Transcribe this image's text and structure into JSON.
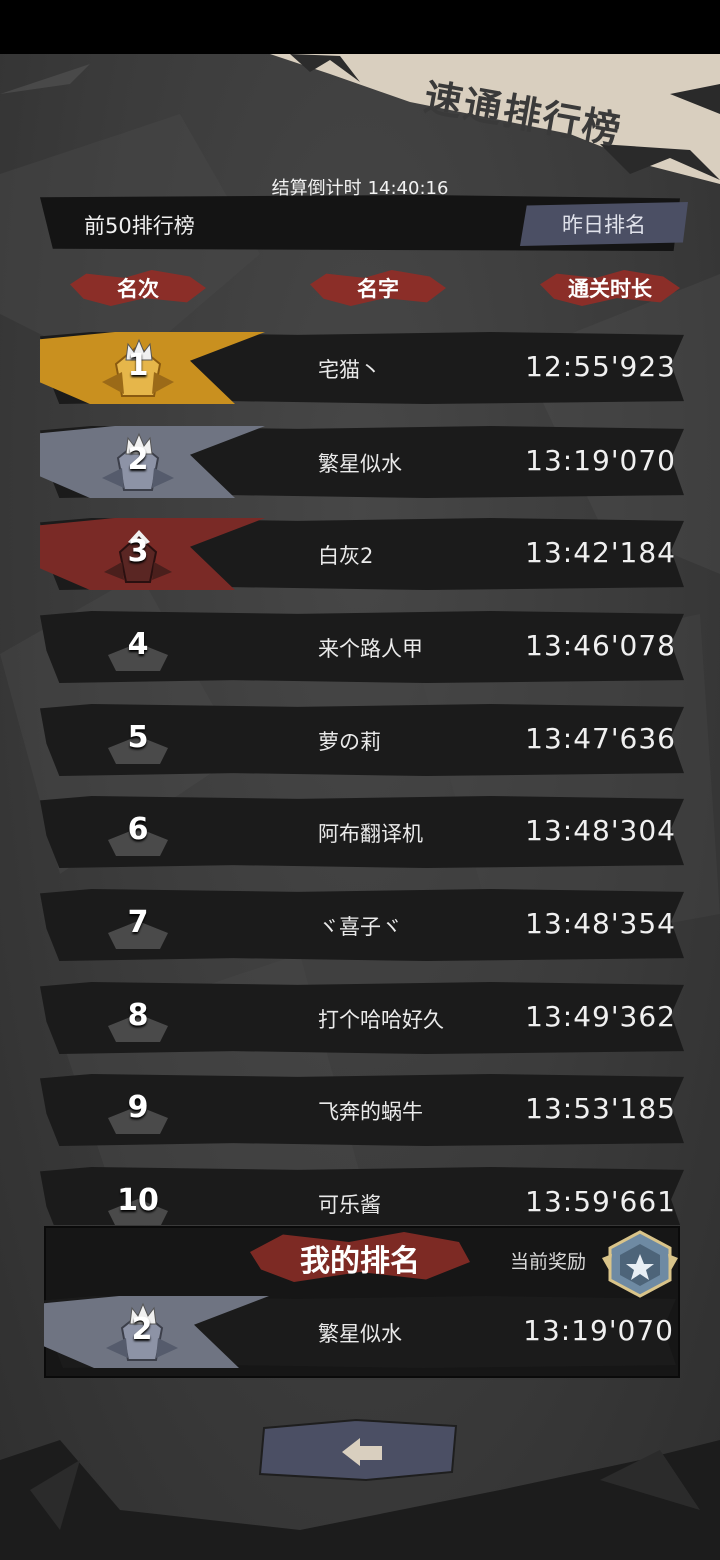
{
  "header": {
    "title": "速通排行榜",
    "countdown_label": "结算倒计时",
    "countdown_value": "14:40:16",
    "top_label": "前50排行榜",
    "yesterday_button": "昨日排名"
  },
  "columns": {
    "rank": "名次",
    "name": "名字",
    "time": "通关时长"
  },
  "rows": [
    {
      "rank": "1",
      "name": "宅猫丶",
      "time": "12:55'923",
      "tier": "gold"
    },
    {
      "rank": "2",
      "name": "繁星似水",
      "time": "13:19'070",
      "tier": "silver"
    },
    {
      "rank": "3",
      "name": "白灰2",
      "time": "13:42'184",
      "tier": "bronze"
    },
    {
      "rank": "4",
      "name": "来个路人甲",
      "time": "13:46'078",
      "tier": "plain"
    },
    {
      "rank": "5",
      "name": "萝の莉",
      "time": "13:47'636",
      "tier": "plain"
    },
    {
      "rank": "6",
      "name": "阿布翻译机",
      "time": "13:48'304",
      "tier": "plain"
    },
    {
      "rank": "7",
      "name": "ヾ喜子ヾ",
      "time": "13:48'354",
      "tier": "plain"
    },
    {
      "rank": "8",
      "name": "打个哈哈好久",
      "time": "13:49'362",
      "tier": "plain"
    },
    {
      "rank": "9",
      "name": "飞奔的蜗牛",
      "time": "13:53'185",
      "tier": "plain"
    },
    {
      "rank": "10",
      "name": "可乐酱",
      "time": "13:59'661",
      "tier": "plain"
    }
  ],
  "my_rank": {
    "title": "我的排名",
    "reward_label": "当前奖励",
    "rank": "2",
    "name": "繁星似水",
    "time": "13:19'070",
    "tier": "silver"
  },
  "colors": {
    "gold": "#c9901f",
    "silver": "#6f7482",
    "bronze": "#7a2a26",
    "accent_red": "#8f2d27",
    "button": "#4b4f64"
  },
  "icons": {
    "back": "back-arrow-icon",
    "crown": "crown-icon",
    "reward": "reward-medal-icon"
  }
}
